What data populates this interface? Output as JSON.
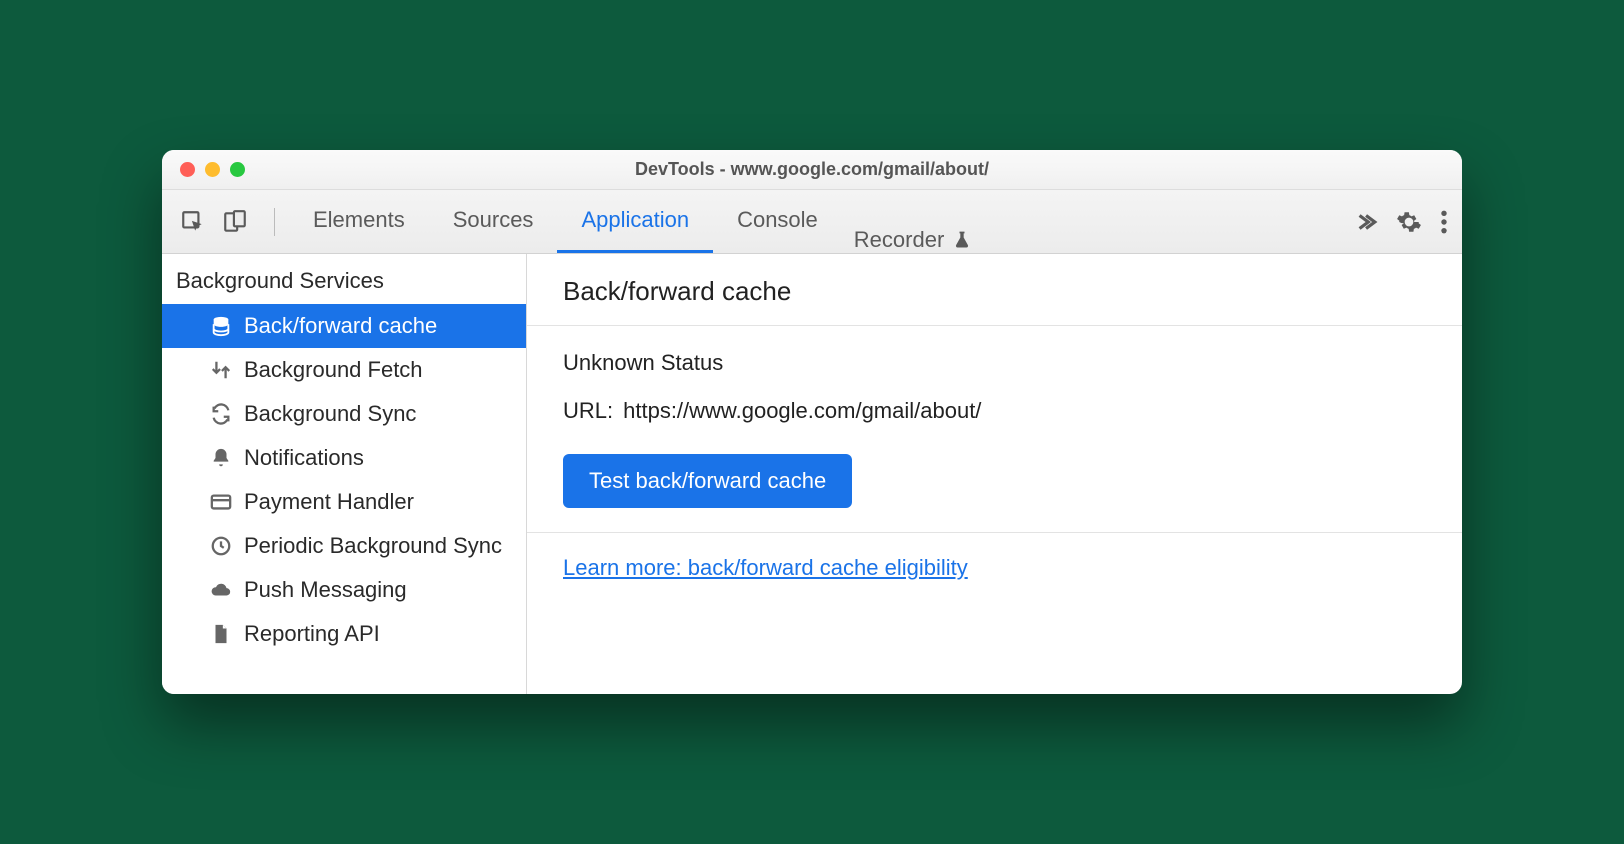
{
  "window": {
    "title": "DevTools - www.google.com/gmail/about/"
  },
  "toolbar": {
    "tabs": [
      "Elements",
      "Sources",
      "Application",
      "Console"
    ],
    "active_tab": "Application",
    "recorder_label": "Recorder"
  },
  "sidebar": {
    "heading": "Background Services",
    "items": [
      {
        "label": "Back/forward cache",
        "icon": "database",
        "selected": true
      },
      {
        "label": "Background Fetch",
        "icon": "fetch",
        "selected": false
      },
      {
        "label": "Background Sync",
        "icon": "sync",
        "selected": false
      },
      {
        "label": "Notifications",
        "icon": "bell",
        "selected": false
      },
      {
        "label": "Payment Handler",
        "icon": "card",
        "selected": false
      },
      {
        "label": "Periodic Background Sync",
        "icon": "clock",
        "selected": false
      },
      {
        "label": "Push Messaging",
        "icon": "cloud",
        "selected": false
      },
      {
        "label": "Reporting API",
        "icon": "file",
        "selected": false
      }
    ]
  },
  "main": {
    "title": "Back/forward cache",
    "status": "Unknown Status",
    "url_label": "URL:",
    "url_value": "https://www.google.com/gmail/about/",
    "test_button": "Test back/forward cache",
    "learn_more": "Learn more: back/forward cache eligibility"
  }
}
